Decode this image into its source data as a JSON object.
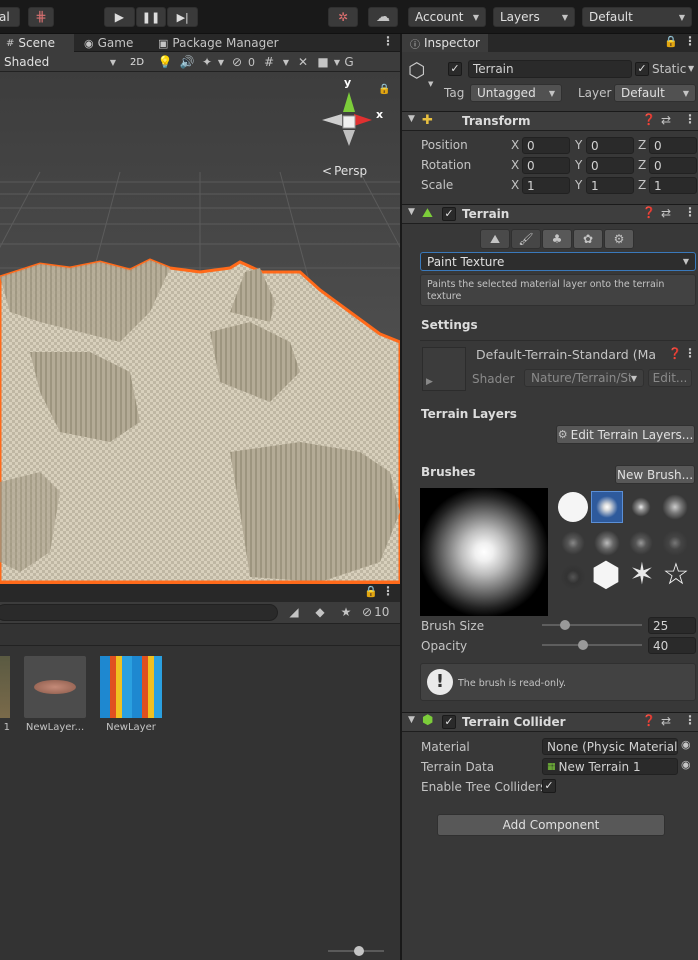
{
  "toolbar": {
    "left_menu_label": "al",
    "account_label": "Account",
    "layers_label": "Layers",
    "layout_label": "Default"
  },
  "scene": {
    "tabs": [
      {
        "label": "Scene"
      },
      {
        "label": "Game"
      },
      {
        "label": "Package Manager"
      }
    ],
    "shading_mode": "Shaded",
    "mode_2d_label": "2D",
    "hidden_count": "0",
    "persp_label": "Persp",
    "gizmo_y_label": "y",
    "gizmo_x_label": "x"
  },
  "project": {
    "hidden_count": "10",
    "assets": [
      {
        "label": "1"
      },
      {
        "label": "NewLayer..."
      },
      {
        "label": "NewLayer"
      }
    ]
  },
  "inspector": {
    "tab_label": "Inspector",
    "object_name": "Terrain",
    "static_label": "Static",
    "tag_label": "Tag",
    "tag_value": "Untagged",
    "layer_label": "Layer",
    "layer_value": "Default",
    "transform": {
      "title": "Transform",
      "rows": [
        {
          "label": "Position",
          "x": "0",
          "y": "0",
          "z": "0"
        },
        {
          "label": "Rotation",
          "x": "0",
          "y": "0",
          "z": "0"
        },
        {
          "label": "Scale",
          "x": "1",
          "y": "1",
          "z": "1"
        }
      ],
      "axis_x": "X",
      "axis_y": "Y",
      "axis_z": "Z"
    },
    "terrain": {
      "title": "Terrain",
      "tool_value": "Paint Texture",
      "tool_description": "Paints the selected material layer onto the terrain texture",
      "settings_label": "Settings",
      "material_name": "Default-Terrain-Standard (Ma",
      "shader_label": "Shader",
      "shader_value": "Nature/Terrain/Sta",
      "edit_label": "Edit...",
      "terrain_layers_label": "Terrain Layers",
      "edit_layers_button": "Edit Terrain Layers...",
      "brushes_label": "Brushes",
      "new_brush_button": "New Brush...",
      "brush_size_label": "Brush Size",
      "brush_size_value": "25",
      "brush_size_fraction": 0.2,
      "opacity_label": "Opacity",
      "opacity_value": "40",
      "opacity_fraction": 0.4,
      "readonly_message": "The brush is read-only."
    },
    "collider": {
      "title": "Terrain Collider",
      "material_label": "Material",
      "material_value": "None (Physic Material)",
      "terrain_data_label": "Terrain Data",
      "terrain_data_value": "New Terrain 1",
      "tree_colliders_label": "Enable Tree Colliders"
    },
    "add_component_button": "Add Component"
  }
}
